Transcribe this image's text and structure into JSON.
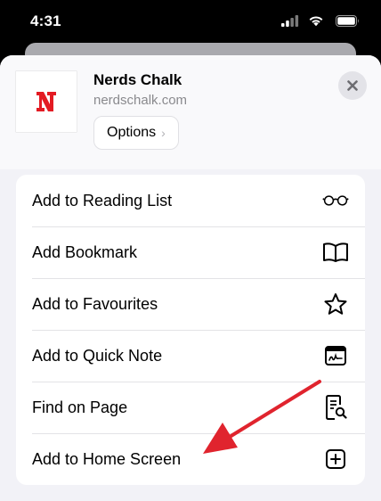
{
  "status_bar": {
    "time": "4:31"
  },
  "site": {
    "name": "Nerds Chalk",
    "url": "nerdschalk.com",
    "logo_letter": "N",
    "options_label": "Options",
    "brand_color": "#e31b23"
  },
  "menu": {
    "items": [
      {
        "label": "Add to Reading List",
        "icon": "glasses-icon"
      },
      {
        "label": "Add Bookmark",
        "icon": "book-icon"
      },
      {
        "label": "Add to Favourites",
        "icon": "star-icon"
      },
      {
        "label": "Add to Quick Note",
        "icon": "quick-note-icon"
      },
      {
        "label": "Find on Page",
        "icon": "find-on-page-icon"
      },
      {
        "label": "Add to Home Screen",
        "icon": "add-square-icon"
      }
    ]
  },
  "annotation": {
    "arrow_color": "#e0242e"
  }
}
